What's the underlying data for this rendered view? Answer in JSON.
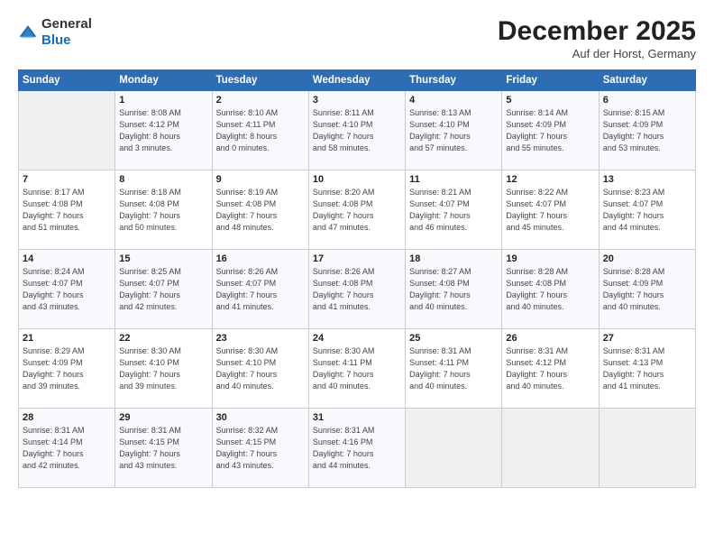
{
  "logo": {
    "line1": "General",
    "line2": "Blue"
  },
  "header": {
    "month": "December 2025",
    "location": "Auf der Horst, Germany"
  },
  "weekdays": [
    "Sunday",
    "Monday",
    "Tuesday",
    "Wednesday",
    "Thursday",
    "Friday",
    "Saturday"
  ],
  "weeks": [
    [
      {
        "day": "",
        "info": ""
      },
      {
        "day": "1",
        "info": "Sunrise: 8:08 AM\nSunset: 4:12 PM\nDaylight: 8 hours\nand 3 minutes."
      },
      {
        "day": "2",
        "info": "Sunrise: 8:10 AM\nSunset: 4:11 PM\nDaylight: 8 hours\nand 0 minutes."
      },
      {
        "day": "3",
        "info": "Sunrise: 8:11 AM\nSunset: 4:10 PM\nDaylight: 7 hours\nand 58 minutes."
      },
      {
        "day": "4",
        "info": "Sunrise: 8:13 AM\nSunset: 4:10 PM\nDaylight: 7 hours\nand 57 minutes."
      },
      {
        "day": "5",
        "info": "Sunrise: 8:14 AM\nSunset: 4:09 PM\nDaylight: 7 hours\nand 55 minutes."
      },
      {
        "day": "6",
        "info": "Sunrise: 8:15 AM\nSunset: 4:09 PM\nDaylight: 7 hours\nand 53 minutes."
      }
    ],
    [
      {
        "day": "7",
        "info": "Sunrise: 8:17 AM\nSunset: 4:08 PM\nDaylight: 7 hours\nand 51 minutes."
      },
      {
        "day": "8",
        "info": "Sunrise: 8:18 AM\nSunset: 4:08 PM\nDaylight: 7 hours\nand 50 minutes."
      },
      {
        "day": "9",
        "info": "Sunrise: 8:19 AM\nSunset: 4:08 PM\nDaylight: 7 hours\nand 48 minutes."
      },
      {
        "day": "10",
        "info": "Sunrise: 8:20 AM\nSunset: 4:08 PM\nDaylight: 7 hours\nand 47 minutes."
      },
      {
        "day": "11",
        "info": "Sunrise: 8:21 AM\nSunset: 4:07 PM\nDaylight: 7 hours\nand 46 minutes."
      },
      {
        "day": "12",
        "info": "Sunrise: 8:22 AM\nSunset: 4:07 PM\nDaylight: 7 hours\nand 45 minutes."
      },
      {
        "day": "13",
        "info": "Sunrise: 8:23 AM\nSunset: 4:07 PM\nDaylight: 7 hours\nand 44 minutes."
      }
    ],
    [
      {
        "day": "14",
        "info": "Sunrise: 8:24 AM\nSunset: 4:07 PM\nDaylight: 7 hours\nand 43 minutes."
      },
      {
        "day": "15",
        "info": "Sunrise: 8:25 AM\nSunset: 4:07 PM\nDaylight: 7 hours\nand 42 minutes."
      },
      {
        "day": "16",
        "info": "Sunrise: 8:26 AM\nSunset: 4:07 PM\nDaylight: 7 hours\nand 41 minutes."
      },
      {
        "day": "17",
        "info": "Sunrise: 8:26 AM\nSunset: 4:08 PM\nDaylight: 7 hours\nand 41 minutes."
      },
      {
        "day": "18",
        "info": "Sunrise: 8:27 AM\nSunset: 4:08 PM\nDaylight: 7 hours\nand 40 minutes."
      },
      {
        "day": "19",
        "info": "Sunrise: 8:28 AM\nSunset: 4:08 PM\nDaylight: 7 hours\nand 40 minutes."
      },
      {
        "day": "20",
        "info": "Sunrise: 8:28 AM\nSunset: 4:09 PM\nDaylight: 7 hours\nand 40 minutes."
      }
    ],
    [
      {
        "day": "21",
        "info": "Sunrise: 8:29 AM\nSunset: 4:09 PM\nDaylight: 7 hours\nand 39 minutes."
      },
      {
        "day": "22",
        "info": "Sunrise: 8:30 AM\nSunset: 4:10 PM\nDaylight: 7 hours\nand 39 minutes."
      },
      {
        "day": "23",
        "info": "Sunrise: 8:30 AM\nSunset: 4:10 PM\nDaylight: 7 hours\nand 40 minutes."
      },
      {
        "day": "24",
        "info": "Sunrise: 8:30 AM\nSunset: 4:11 PM\nDaylight: 7 hours\nand 40 minutes."
      },
      {
        "day": "25",
        "info": "Sunrise: 8:31 AM\nSunset: 4:11 PM\nDaylight: 7 hours\nand 40 minutes."
      },
      {
        "day": "26",
        "info": "Sunrise: 8:31 AM\nSunset: 4:12 PM\nDaylight: 7 hours\nand 40 minutes."
      },
      {
        "day": "27",
        "info": "Sunrise: 8:31 AM\nSunset: 4:13 PM\nDaylight: 7 hours\nand 41 minutes."
      }
    ],
    [
      {
        "day": "28",
        "info": "Sunrise: 8:31 AM\nSunset: 4:14 PM\nDaylight: 7 hours\nand 42 minutes."
      },
      {
        "day": "29",
        "info": "Sunrise: 8:31 AM\nSunset: 4:15 PM\nDaylight: 7 hours\nand 43 minutes."
      },
      {
        "day": "30",
        "info": "Sunrise: 8:32 AM\nSunset: 4:15 PM\nDaylight: 7 hours\nand 43 minutes."
      },
      {
        "day": "31",
        "info": "Sunrise: 8:31 AM\nSunset: 4:16 PM\nDaylight: 7 hours\nand 44 minutes."
      },
      {
        "day": "",
        "info": ""
      },
      {
        "day": "",
        "info": ""
      },
      {
        "day": "",
        "info": ""
      }
    ]
  ]
}
